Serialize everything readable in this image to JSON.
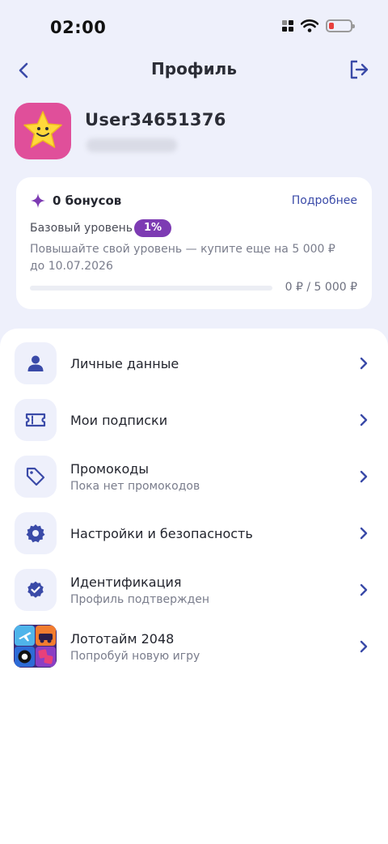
{
  "status_bar": {
    "time": "02:00"
  },
  "header": {
    "title": "Профиль"
  },
  "user": {
    "name": "User34651376"
  },
  "bonus": {
    "count_label": "0 бонусов",
    "details_label": "Подробнее",
    "level_label": "Базовый уровень",
    "level_badge": "1%",
    "level_text": "Повышайте свой уровень — купите еще на 5 000 ₽ до 10.07.2026",
    "progress_text": "0 ₽ / 5 000 ₽",
    "progress_fraction": 0
  },
  "menu": [
    {
      "title": "Личные данные",
      "subtitle": "",
      "icon": "user-icon"
    },
    {
      "title": "Мои подписки",
      "subtitle": "",
      "icon": "ticket-icon"
    },
    {
      "title": "Промокоды",
      "subtitle": "Пока нет промокодов",
      "icon": "tag-icon"
    },
    {
      "title": "Настройки и безопасность",
      "subtitle": "",
      "icon": "gear-icon"
    },
    {
      "title": "Идентификация",
      "subtitle": "Профиль подтвержден",
      "icon": "verified-check-icon"
    },
    {
      "title": "Лототайм 2048",
      "subtitle": "Попробуй новую игру",
      "icon": "game-app-icon"
    }
  ],
  "colors": {
    "accent": "#3a4aa8",
    "badge": "#7d3bb3",
    "header_bg": "#eef0fb",
    "avatar_bg": "#e04f9a"
  }
}
